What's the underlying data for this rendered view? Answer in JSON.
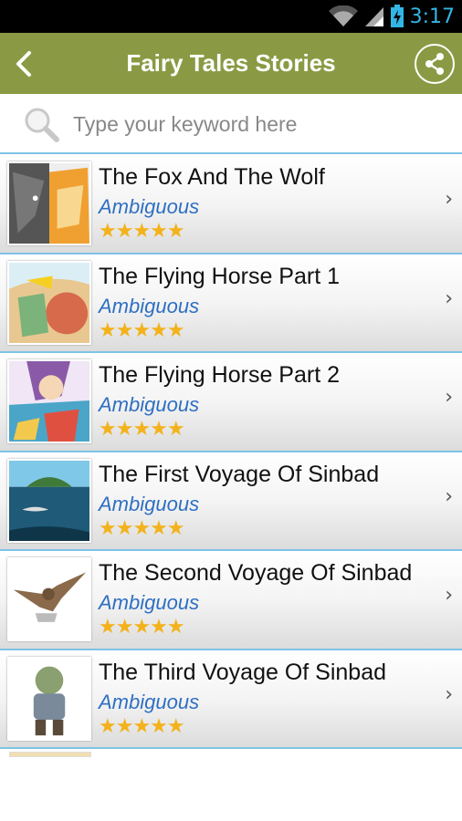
{
  "status_bar": {
    "time": "3:17",
    "wifi_icon": "wifi-icon",
    "signal_icon": "signal-icon",
    "battery_icon": "battery-charging-icon"
  },
  "app_bar": {
    "title": "Fairy Tales Stories",
    "back_icon": "chevron-left-icon",
    "share_icon": "share-icon"
  },
  "search": {
    "placeholder": "Type your keyword here",
    "value": "",
    "icon": "search-icon"
  },
  "stories": [
    {
      "title": "The Fox And The Wolf",
      "author": "Ambiguous",
      "stars": "★★★★★",
      "rating": 5,
      "thumb": "fox-wolf"
    },
    {
      "title": "The Flying Horse Part 1",
      "author": "Ambiguous",
      "stars": "★★★★★",
      "rating": 5,
      "thumb": "flying-horse-1"
    },
    {
      "title": "The Flying Horse Part 2",
      "author": "Ambiguous",
      "stars": "★★★★★",
      "rating": 5,
      "thumb": "flying-horse-2"
    },
    {
      "title": "The First Voyage Of Sinbad",
      "author": "Ambiguous",
      "stars": "★★★★★",
      "rating": 5,
      "thumb": "island-whale"
    },
    {
      "title": "The Second Voyage Of Sinbad",
      "author": "Ambiguous",
      "stars": "★★★★★",
      "rating": 5,
      "thumb": "eagle"
    },
    {
      "title": "The Third Voyage Of Sinbad",
      "author": "Ambiguous",
      "stars": "★★★★★",
      "rating": 5,
      "thumb": "giant"
    }
  ],
  "colors": {
    "app_bar": "#8a9a44",
    "divider": "#7fc3e6",
    "author": "#2e6fc2",
    "stars": "#f3b21b",
    "status_time": "#33b5e5"
  }
}
